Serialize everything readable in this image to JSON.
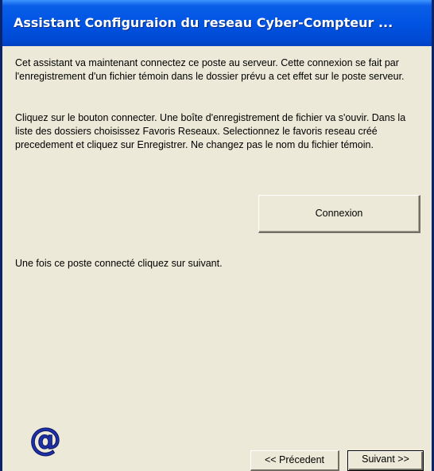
{
  "window": {
    "title": "Assistant Configuraion du reseau Cyber-Compteur ..."
  },
  "content": {
    "paragraph_1": "Cet assistant va maintenant connectez ce poste au serveur. Cette connexion se fait par l'enregistrement d'un fichier témoin dans le dossier prévu a cet effet sur le poste serveur.",
    "paragraph_2": "Cliquez sur le bouton connecter. Une boîte d'enregistrement de fichier va s'ouvir. Dans la liste des dossiers choisissez Favoris Reseaux. Selectionnez le favoris reseau créé precedement et cliquez sur Enregistrer. Ne changez pas le nom du fichier témoin.",
    "paragraph_3": "Une fois ce poste connecté cliquez sur suivant."
  },
  "buttons": {
    "connect_label": "Connexion",
    "previous_label": "<< Précedent",
    "next_label": "Suivant >>"
  },
  "logo": {
    "text": "@",
    "icon": "at-sign-icon",
    "color": "#1E2FA8"
  },
  "colors": {
    "title_bar": "#0054E3",
    "window_background": "#ECE9D8",
    "frame_border": "#0A246A"
  }
}
